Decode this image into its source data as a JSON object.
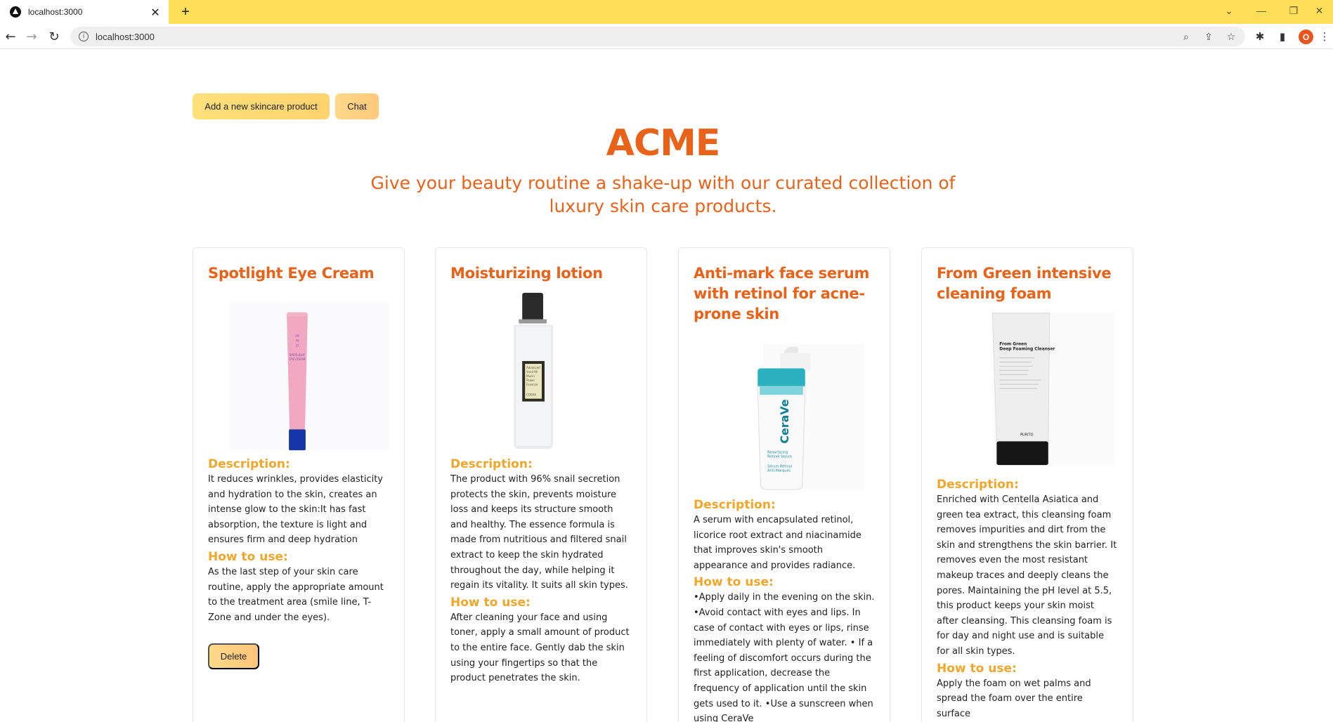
{
  "browser": {
    "tab_title": "localhost:3000",
    "url": "localhost:3000",
    "profile_initial": "O"
  },
  "header": {
    "add_button": "Add a new skincare product",
    "chat_button": "Chat",
    "brand": "ACME",
    "tagline": "Give your beauty routine a shake-up with our curated collection of luxury skin care products."
  },
  "labels": {
    "description": "Description:",
    "how_to_use": "How to use:",
    "delete": "Delete"
  },
  "products": [
    {
      "title": "Spotlight Eye Cream",
      "description": "It reduces wrinkles, provides elasticity and hydration to the skin, creates an intense glow to the skin:It has fast absorption, the texture is light and ensures firm and deep hydration",
      "how_to_use": "As the last step of your skin care routine, apply the appropriate amount to the treatment area (smile line, T-Zone and under the eyes).",
      "image": "pink-eye-cream-tube"
    },
    {
      "title": "Moisturizing lotion",
      "description": "The product with 96% snail secretion protects the skin, prevents moisture loss and keeps its structure smooth and healthy. The essence formula is made from nutritious and filtered snail extract to keep the skin hydrated throughout the day, while helping it regain its vitality. It suits all skin types.",
      "how_to_use": "After cleaning your face and using toner, apply a small amount of product to the entire face. Gently dab the skin using your fingertips so that the product penetrates the skin.",
      "image": "clear-essence-bottle"
    },
    {
      "title": "Anti-mark face serum with retinol for acne-prone skin",
      "description": "A serum with encapsulated retinol, licorice root extract and niacinamide that improves skin's smooth appearance and provides radiance.",
      "how_to_use": "•Apply daily in the evening on the skin. •Avoid contact with eyes and lips. In case of contact with eyes or lips, rinse immediately with plenty of water. • If a feeling of discomfort occurs during the first application, decrease the frequency of application until the skin gets used to it. •Use a sunscreen when using CeraVe",
      "image": "cerave-serum-pump"
    },
    {
      "title": "From Green intensive cleaning foam",
      "description": "Enriched with Centella Asiatica and green tea extract, this cleansing foam removes impurities and dirt from the skin and strengthens the skin barrier. It removes even the most resistant makeup traces and deeply cleans the pores. Maintaining the pH level at 5.5, this product keeps your skin moist after cleansing. This cleansing foam is for day and night use and is suitable for all skin types.",
      "how_to_use": "Apply the foam on wet palms and spread the foam over the entire surface",
      "image": "white-cleanser-tube"
    }
  ],
  "package_text": {
    "eye_cream": [
      "so",
      "ro",
      "ci",
      "SPOTLIGHT",
      "EYE CREAM"
    ],
    "snail": [
      "Advanced",
      "Snail 96",
      "Mucin",
      "Power",
      "Essence",
      "COSRX"
    ],
    "cerave": [
      "CeraVe",
      "Resurfacing",
      "Retinol Serum",
      "Sérum Rétinol",
      "Anti-Marques"
    ],
    "purito": [
      "From Green",
      "Deep Foaming Cleanser",
      "PURITO"
    ]
  },
  "colors": {
    "tabbar": "#ffde5a",
    "brand_orange": "#e8621a",
    "section_yellow": "#f0a62a",
    "button_yellow": "#ffd96e"
  }
}
